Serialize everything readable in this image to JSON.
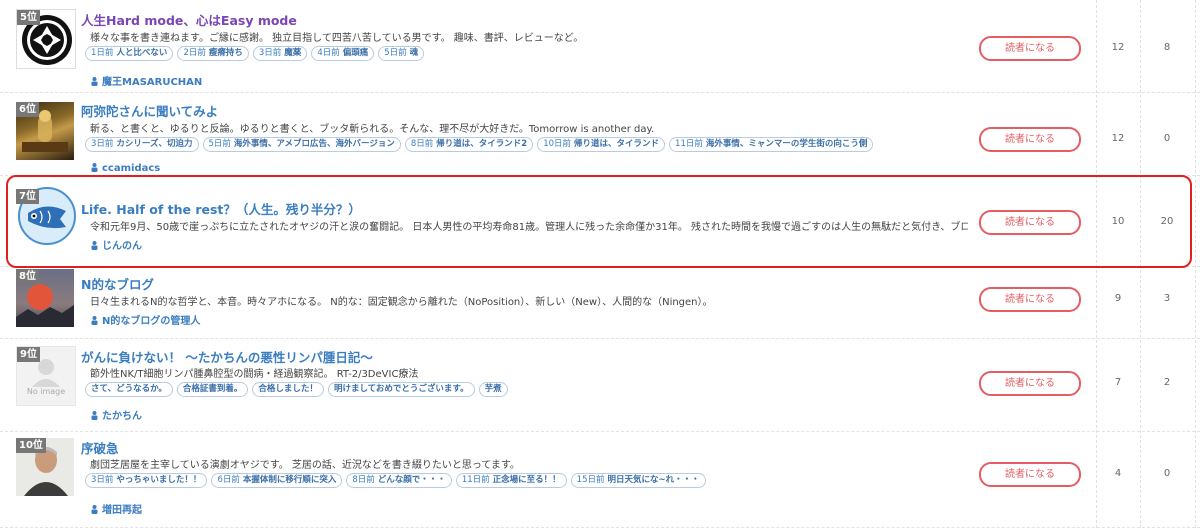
{
  "follow_label": "読者になる",
  "highlight_color": "#e02020",
  "rows": [
    {
      "rank": "5位",
      "title": "人生Hard mode、心はEasy mode",
      "desc": "様々な事を書き連ねます。ご縁に感謝。 独立目指して四苦八苦している男です。 趣味、書評、レビューなど。",
      "tags": [
        {
          "d": "1日前",
          "t": "人と比べない"
        },
        {
          "d": "2日前",
          "t": "瘦瘠持ち"
        },
        {
          "d": "3日前",
          "t": "魔薬"
        },
        {
          "d": "4日前",
          "t": "偏頭痛"
        },
        {
          "d": "5日前",
          "t": "魂"
        }
      ],
      "user": "魔王MASARUCHAN",
      "n1": "12",
      "n2": "8"
    },
    {
      "rank": "6位",
      "title": "阿弥陀さんに聞いてみよ",
      "desc": "斬る、と書くと、ゆるりと反論。ゆるりと書くと、ブッタ斬られる。そんな、理不尽が大好きだ。Tomorrow is another day.",
      "tags": [
        {
          "d": "3日前",
          "t": "カシリーズ、切迫力"
        },
        {
          "d": "5日前",
          "t": "海外事情、アメブロ広告、海外バージョン"
        },
        {
          "d": "8日前",
          "t": "帰り道は、タイランド2"
        },
        {
          "d": "10日前",
          "t": "帰り道は、タイランド"
        },
        {
          "d": "11日前",
          "t": "海外事情、ミャンマーの学生街の向こう側"
        }
      ],
      "user": "ccamidacs",
      "n1": "12",
      "n2": "0"
    },
    {
      "rank": "7位",
      "title": "Life. Half of the rest？（人生。残り半分？）",
      "desc": "令和元年9月、50歳で崖っぷちに立たされたオヤジの汗と涙の奮闘記。 日本人男性の平均寿命81歳。管理人に残った余命僅か31年。 残された時間を我慢で過ごすのは人生の無駄だと気付き、ブロ",
      "tags": [],
      "user": "じんのん",
      "n1": "10",
      "n2": "20"
    },
    {
      "rank": "8位",
      "title": "N的なブログ",
      "desc": "日々生まれるN的な哲学と、本音。時々アホになる。 N的な：固定観念から離れた（NoPosition）、新しい（New）、人間的な（Ningen）。",
      "tags": [],
      "user": "N的なブログの管理人",
      "n1": "9",
      "n2": "3"
    },
    {
      "rank": "9位",
      "title": "がんに負けない！ ～たかちんの悪性リンパ腫日記～",
      "desc": "節外性NK/T細胞リンパ腫鼻腔型の闘病・経過観察記。 RT-2/3DeVIC療法",
      "tags": [
        {
          "d": "",
          "t": "さて、どうなるか。"
        },
        {
          "d": "",
          "t": "合格証書到着。"
        },
        {
          "d": "",
          "t": "合格しました！"
        },
        {
          "d": "",
          "t": "明けましておめでとうございます。"
        },
        {
          "d": "",
          "t": "芋煮"
        }
      ],
      "user": "たかちん",
      "n1": "7",
      "n2": "2",
      "noimage": "No image"
    },
    {
      "rank": "10位",
      "title": "序破急",
      "desc": "劇団芝居屋を主宰している演劇オヤジです。 芝居の話、近況などを書き綴りたいと思ってます。",
      "tags": [
        {
          "d": "3日前",
          "t": "やっちゃいました！！"
        },
        {
          "d": "6日前",
          "t": "本握体制に移行順に突入"
        },
        {
          "d": "8日前",
          "t": "どんな顔で・・・"
        },
        {
          "d": "11日前",
          "t": "正念場に至る！！"
        },
        {
          "d": "15日前",
          "t": "明日天気にな~れ・・・"
        }
      ],
      "user": "増田再起",
      "n1": "4",
      "n2": "0"
    }
  ]
}
